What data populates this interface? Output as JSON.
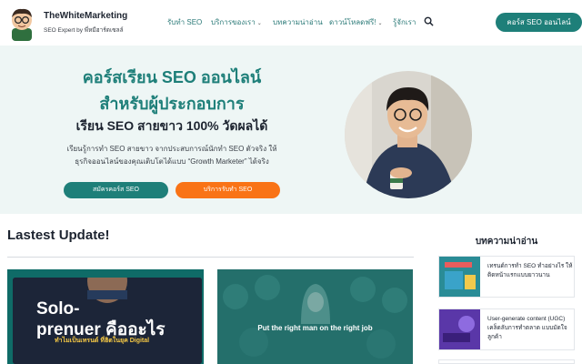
{
  "header": {
    "brand_name": "TheWhiteMarketing",
    "brand_tagline": "SEO Expert by พี่หมีฮาร์ดเซลล์",
    "nav": [
      {
        "label": "รับทำ SEO",
        "has_dropdown": false
      },
      {
        "label": "บริการของเรา",
        "has_dropdown": true
      },
      {
        "label": "บทความน่าอ่าน",
        "has_dropdown": false
      },
      {
        "label": "ดาวน์โหลดฟรี!",
        "has_dropdown": true
      },
      {
        "label": "รู้จักเรา",
        "has_dropdown": false
      }
    ],
    "search_icon": "search-icon",
    "cta_label": "คอร์ส SEO ออนไลน์"
  },
  "hero": {
    "title_line1": "คอร์สเรียน SEO ออนไลน์",
    "title_line2": "สำหรับผู้ประกอบการ",
    "title_line3": "เรียน SEO สายขาว 100% วัดผลได้",
    "description_line1": "เรียนรู้การทำ SEO สายขาว จากประสบการณ์นักทำ SEO ตัวจริง ให้",
    "description_line2": "ธุรกิจออนไลน์ของคุณเติบโตได้แบบ “Growth Marketer” ได้จริง",
    "button_course": "สมัครคอร์ส SEO",
    "button_service": "บริการรับทำ SEO"
  },
  "latest": {
    "title": "Lastest Update!",
    "cards": [
      {
        "line1": "Solo-",
        "line2": "prenuer คืออะไร",
        "line3": "ทำไมเป็นเทรนด์ ที่ฮิตในยุค Digital"
      },
      {
        "text": "Put the right man on the right job"
      }
    ]
  },
  "sidebar": {
    "title": "บทความน่าอ่าน",
    "items": [
      {
        "text": "เทรนด์การทำ SEO ทำอย่างไร ให้ติดหน้าแรกแบบยาวนาน"
      },
      {
        "text": "User-generate content (UGC) เคล็ดลับการทำตลาด แบบมัดใจลูกค้า"
      }
    ]
  },
  "colors": {
    "brand": "#1e7f79",
    "accent": "#f97316",
    "hero_bg": "#eef6f5"
  }
}
